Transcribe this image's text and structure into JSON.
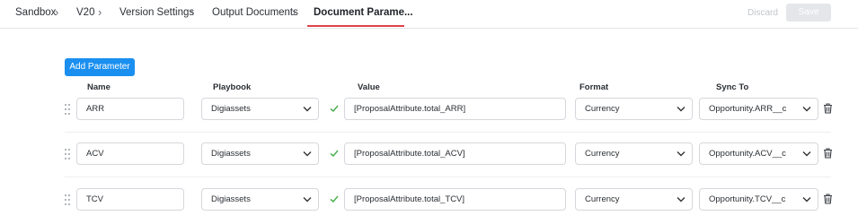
{
  "breadcrumb": {
    "items": [
      "Sandbox",
      "V20",
      "Version Settings",
      "Output Documents"
    ],
    "current": "Document Parame..."
  },
  "toolbar": {
    "discard_label": "Discard",
    "save_label": "Save"
  },
  "main": {
    "add_button_label": "Add Parameter",
    "columns": {
      "name": "Name",
      "playbook": "Playbook",
      "value": "Value",
      "format": "Format",
      "sync_to": "Sync To"
    },
    "rows": [
      {
        "name": "ARR",
        "playbook": "Digiassets",
        "value": "[ProposalAttribute.total_ARR]",
        "format": "Currency",
        "sync_to": "Opportunity.ARR__c"
      },
      {
        "name": "ACV",
        "playbook": "Digiassets",
        "value": "[ProposalAttribute.total_ACV]",
        "format": "Currency",
        "sync_to": "Opportunity.ACV__c"
      },
      {
        "name": "TCV",
        "playbook": "Digiassets",
        "value": "[ProposalAttribute.total_TCV]",
        "format": "Currency",
        "sync_to": "Opportunity.TCV__c"
      }
    ]
  },
  "colors": {
    "accent": "#1a8ff0",
    "active_tab": "#e0424a",
    "valid_check": "#4caf50"
  }
}
